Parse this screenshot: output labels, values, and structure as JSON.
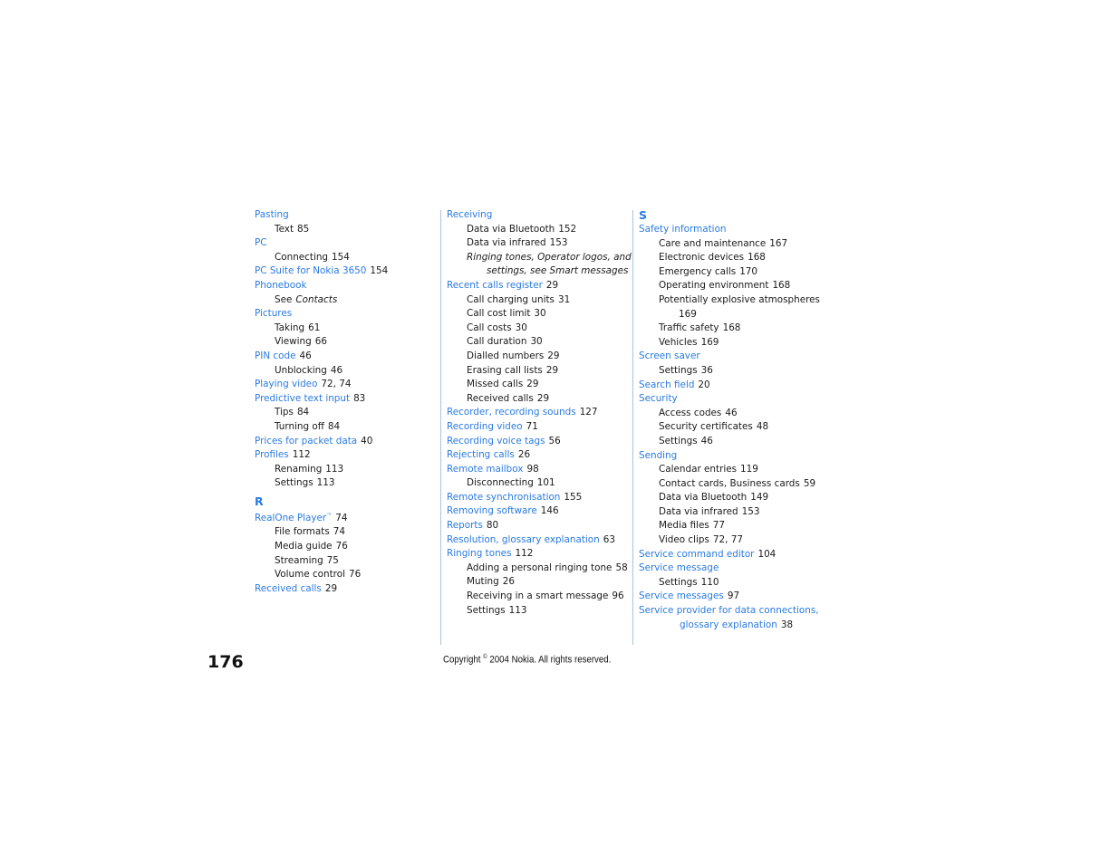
{
  "page_number": "176",
  "copyright": {
    "prefix": "Copyright",
    "symbol": "©",
    "text": "2004 Nokia. All rights reserved."
  },
  "colors": {
    "link": "#2a7ae2",
    "divider": "#a9c3e0",
    "text": "#1a1a1a"
  },
  "columns": [
    {
      "entries": [
        {
          "type": "main",
          "term": "Pasting",
          "pages": ""
        },
        {
          "type": "sub",
          "term": "Text",
          "pages": "85"
        },
        {
          "type": "main",
          "term": "PC",
          "pages": ""
        },
        {
          "type": "sub",
          "term": "Connecting",
          "pages": "154"
        },
        {
          "type": "main",
          "term": "PC Suite for Nokia 3650",
          "pages": "154"
        },
        {
          "type": "main",
          "term": "Phonebook",
          "pages": ""
        },
        {
          "type": "see",
          "term": "See",
          "ref": "Contacts"
        },
        {
          "type": "main",
          "term": "Pictures",
          "pages": ""
        },
        {
          "type": "sub",
          "term": "Taking",
          "pages": "61"
        },
        {
          "type": "sub",
          "term": "Viewing",
          "pages": "66"
        },
        {
          "type": "main",
          "term": "PIN code",
          "pages": "46"
        },
        {
          "type": "sub",
          "term": "Unblocking",
          "pages": "46"
        },
        {
          "type": "main",
          "term": "Playing video",
          "pages": "72, 74"
        },
        {
          "type": "main",
          "term": "Predictive text input",
          "pages": "83"
        },
        {
          "type": "sub",
          "term": "Tips",
          "pages": "84"
        },
        {
          "type": "sub",
          "term": "Turning off",
          "pages": "84"
        },
        {
          "type": "main",
          "term": "Prices for packet data",
          "pages": "40"
        },
        {
          "type": "main",
          "term": "Profiles",
          "pages": "112"
        },
        {
          "type": "sub",
          "term": "Renaming",
          "pages": "113"
        },
        {
          "type": "sub",
          "term": "Settings",
          "pages": "113"
        },
        {
          "type": "letter",
          "term": "R"
        },
        {
          "type": "main",
          "term": "RealOne Player",
          "tm": "™",
          "pages": "74"
        },
        {
          "type": "sub",
          "term": "File formats",
          "pages": "74"
        },
        {
          "type": "sub",
          "term": "Media guide",
          "pages": "76"
        },
        {
          "type": "sub",
          "term": "Streaming",
          "pages": "75"
        },
        {
          "type": "sub",
          "term": "Volume control",
          "pages": "76"
        },
        {
          "type": "main",
          "term": "Received calls",
          "pages": "29"
        }
      ]
    },
    {
      "entries": [
        {
          "type": "main",
          "term": "Receiving",
          "pages": ""
        },
        {
          "type": "sub",
          "term": "Data via Bluetooth",
          "pages": "152"
        },
        {
          "type": "sub",
          "term": "Data via infrared",
          "pages": "153"
        },
        {
          "type": "italic",
          "line1": "Ringing tones, Operator logos, and",
          "line2": "settings, see Smart messages"
        },
        {
          "type": "main",
          "term": "Recent calls register",
          "pages": "29"
        },
        {
          "type": "sub",
          "term": "Call charging units",
          "pages": "31"
        },
        {
          "type": "sub",
          "term": "Call cost limit",
          "pages": "30"
        },
        {
          "type": "sub",
          "term": "Call costs",
          "pages": "30"
        },
        {
          "type": "sub",
          "term": "Call duration",
          "pages": "30"
        },
        {
          "type": "sub",
          "term": "Dialled numbers",
          "pages": "29"
        },
        {
          "type": "sub",
          "term": "Erasing call lists",
          "pages": "29"
        },
        {
          "type": "sub",
          "term": "Missed calls",
          "pages": "29"
        },
        {
          "type": "sub",
          "term": "Received calls",
          "pages": "29"
        },
        {
          "type": "main",
          "term": "Recorder, recording sounds",
          "pages": "127"
        },
        {
          "type": "main",
          "term": "Recording video",
          "pages": "71"
        },
        {
          "type": "main",
          "term": "Recording voice tags",
          "pages": "56"
        },
        {
          "type": "main",
          "term": "Rejecting calls",
          "pages": "26"
        },
        {
          "type": "main",
          "term": "Remote mailbox",
          "pages": "98"
        },
        {
          "type": "sub",
          "term": "Disconnecting",
          "pages": "101"
        },
        {
          "type": "main",
          "term": "Remote synchronisation",
          "pages": "155"
        },
        {
          "type": "main",
          "term": "Removing software",
          "pages": "146"
        },
        {
          "type": "main",
          "term": "Reports",
          "pages": "80"
        },
        {
          "type": "main",
          "term": "Resolution, glossary explanation",
          "pages": "63"
        },
        {
          "type": "main",
          "term": "Ringing tones",
          "pages": "112"
        },
        {
          "type": "sub",
          "term": "Adding a personal ringing tone",
          "pages": "58"
        },
        {
          "type": "sub",
          "term": "Muting",
          "pages": "26"
        },
        {
          "type": "sub",
          "term": "Receiving in a smart message",
          "pages": "96"
        },
        {
          "type": "sub",
          "term": "Settings",
          "pages": "113"
        }
      ]
    },
    {
      "entries": [
        {
          "type": "letter",
          "term": "S"
        },
        {
          "type": "main",
          "term": "Safety information",
          "pages": ""
        },
        {
          "type": "sub",
          "term": "Care and maintenance",
          "pages": "167"
        },
        {
          "type": "sub",
          "term": "Electronic devices",
          "pages": "168"
        },
        {
          "type": "sub",
          "term": "Emergency calls",
          "pages": "170"
        },
        {
          "type": "sub",
          "term": "Operating environment",
          "pages": "168"
        },
        {
          "type": "subwrap",
          "term": "Potentially explosive atmospheres",
          "pages": "169"
        },
        {
          "type": "sub",
          "term": "Traffic safety",
          "pages": "168"
        },
        {
          "type": "sub",
          "term": "Vehicles",
          "pages": "169"
        },
        {
          "type": "main",
          "term": "Screen saver",
          "pages": ""
        },
        {
          "type": "sub",
          "term": "Settings",
          "pages": "36"
        },
        {
          "type": "main",
          "term": "Search field",
          "pages": "20"
        },
        {
          "type": "main",
          "term": "Security",
          "pages": ""
        },
        {
          "type": "sub",
          "term": "Access codes",
          "pages": "46"
        },
        {
          "type": "sub",
          "term": "Security certificates",
          "pages": "48"
        },
        {
          "type": "sub",
          "term": "Settings",
          "pages": "46"
        },
        {
          "type": "main",
          "term": "Sending",
          "pages": ""
        },
        {
          "type": "sub",
          "term": "Calendar entries",
          "pages": "119"
        },
        {
          "type": "sub",
          "term": "Contact cards, Business cards",
          "pages": "59"
        },
        {
          "type": "sub",
          "term": "Data via Bluetooth",
          "pages": "149"
        },
        {
          "type": "sub",
          "term": "Data via infrared",
          "pages": "153"
        },
        {
          "type": "sub",
          "term": "Media files",
          "pages": "77"
        },
        {
          "type": "sub",
          "term": "Video clips",
          "pages": "72, 77"
        },
        {
          "type": "main",
          "term": "Service command editor",
          "pages": "104"
        },
        {
          "type": "main",
          "term": "Service message",
          "pages": ""
        },
        {
          "type": "sub",
          "term": "Settings",
          "pages": "110"
        },
        {
          "type": "main",
          "term": "Service messages",
          "pages": "97"
        },
        {
          "type": "mainwrap",
          "line1": "Service provider for data connections,",
          "line2": "glossary explanation",
          "pages": "38"
        }
      ]
    }
  ]
}
